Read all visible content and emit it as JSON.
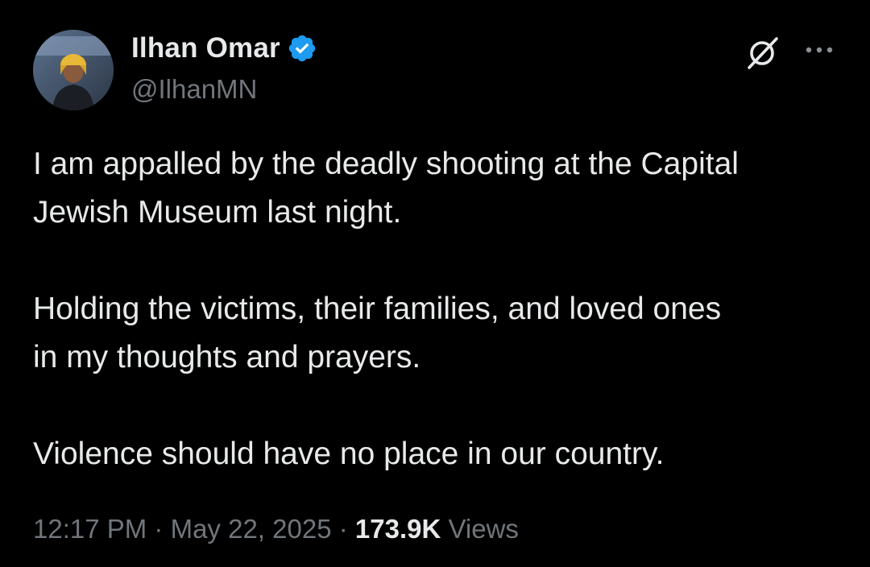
{
  "author": {
    "display_name": "Ilhan Omar",
    "handle": "@IlhanMN",
    "verified": true,
    "verified_color": "#1d9bf0",
    "avatar_icon": "profile-photo"
  },
  "header_actions": {
    "grok_icon": "grok-icon",
    "more_icon": "more-horizontal-icon",
    "more_label": "···"
  },
  "tweet": {
    "paragraphs": [
      "I am appalled by the deadly shooting at the Capital\nJewish Museum last night.",
      "Holding the victims, their families, and loved ones\nin my thoughts and prayers.",
      "Violence should have no place in our country."
    ]
  },
  "meta": {
    "time": "12:17 PM",
    "separator": "·",
    "date": "May 22, 2025",
    "views_count": "173.9K",
    "views_label": "Views"
  },
  "colors": {
    "background": "#000000",
    "primary_text": "#e7e9ea",
    "secondary_text": "#71767b"
  }
}
